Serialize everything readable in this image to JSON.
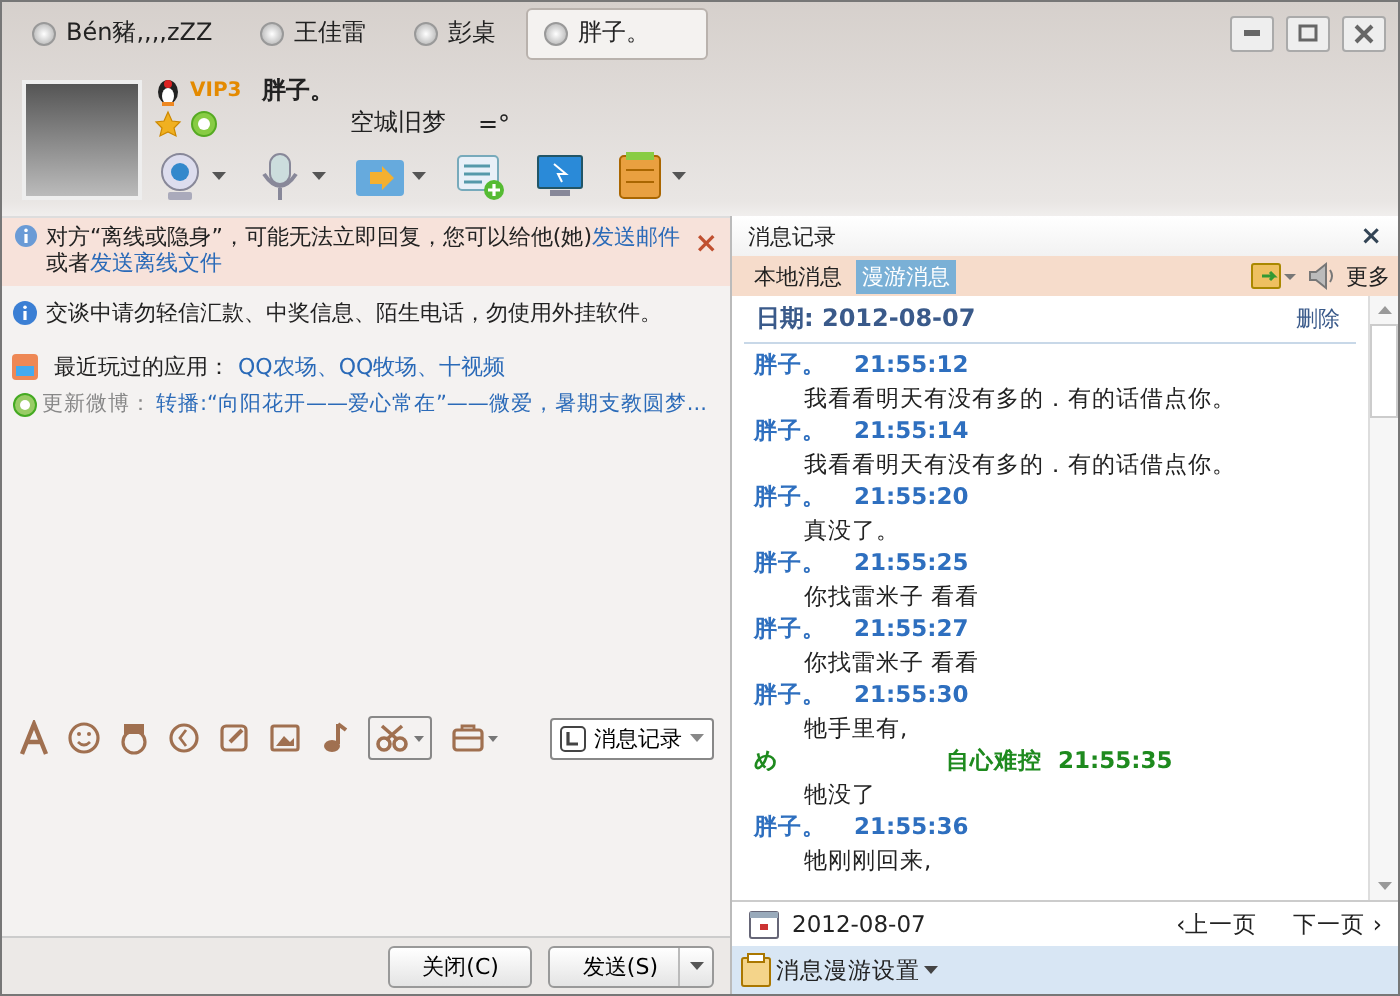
{
  "tabs": [
    {
      "label": "Bén豬,,,,zZZ",
      "selected": false
    },
    {
      "label": "王佳雷",
      "selected": false
    },
    {
      "label": "彭桌",
      "selected": false
    },
    {
      "label": "胖子。",
      "selected": true
    }
  ],
  "contact": {
    "badge": "VIP3",
    "name": "胖子。",
    "signature": "空城旧梦",
    "mood": "=°"
  },
  "notice": {
    "text": "对方“离线或隐身”，可能无法立即回复，您可以给他(她)",
    "link1": "发送邮件",
    "middle": "或者",
    "link2": "发送离线文件",
    "close": "×"
  },
  "warning": "交谈中请勿轻信汇款、中奖信息、陌生电话，勿使用外挂软件。",
  "apps": {
    "label": "最近玩过的应用：",
    "links": "QQ农场、QQ牧场、十视频"
  },
  "weibo": {
    "label": "更新微博：",
    "text": "转播:“向阳花开——爱心常在”——微爱，暑期支教圆梦..."
  },
  "history_button": "消息记录",
  "buttons": [
    {
      "label": "关闭(C)",
      "kind": "plain"
    },
    {
      "label": "发送(S)",
      "kind": "split"
    }
  ],
  "history": {
    "title": "消息记录",
    "close": "×",
    "tabs": [
      {
        "label": "本地消息",
        "selected": false
      },
      {
        "label": "漫游消息",
        "selected": true
      }
    ],
    "more": "更多",
    "date": "日期: 2012-08-07",
    "delete": "删除",
    "messages": [
      {
        "sender": "胖子。",
        "time": "21:55:12",
        "text": "我看看明天有没有多的．有的话借点你。",
        "color": "#2e6fbf"
      },
      {
        "sender": "胖子。",
        "time": "21:55:14",
        "text": "我看看明天有没有多的．有的话借点你。",
        "color": "#2e6fbf"
      },
      {
        "sender": "胖子。",
        "time": "21:55:20",
        "text": "真没了。",
        "color": "#2e6fbf"
      },
      {
        "sender": "胖子。",
        "time": "21:55:25",
        "text": "你找雷米子 看看",
        "color": "#2e6fbf"
      },
      {
        "sender": "胖子。",
        "time": "21:55:27",
        "text": "你找雷米子 看看",
        "color": "#2e6fbf"
      },
      {
        "sender": "胖子。",
        "time": "21:55:30",
        "text": "牠手里有,",
        "color": "#2e6fbf"
      },
      {
        "sender": "め",
        "alias": "自心难控",
        "time": "21:55:35",
        "text": "牠没了",
        "color": "#1e8a1e"
      },
      {
        "sender": "胖子。",
        "time": "21:55:36",
        "text": "牠刚刚回来,",
        "color": "#2e6fbf"
      }
    ],
    "footer_date": "2012-08-07",
    "prev": "‹上一页",
    "next": "下一页 ›",
    "settings": "消息漫游设置"
  }
}
